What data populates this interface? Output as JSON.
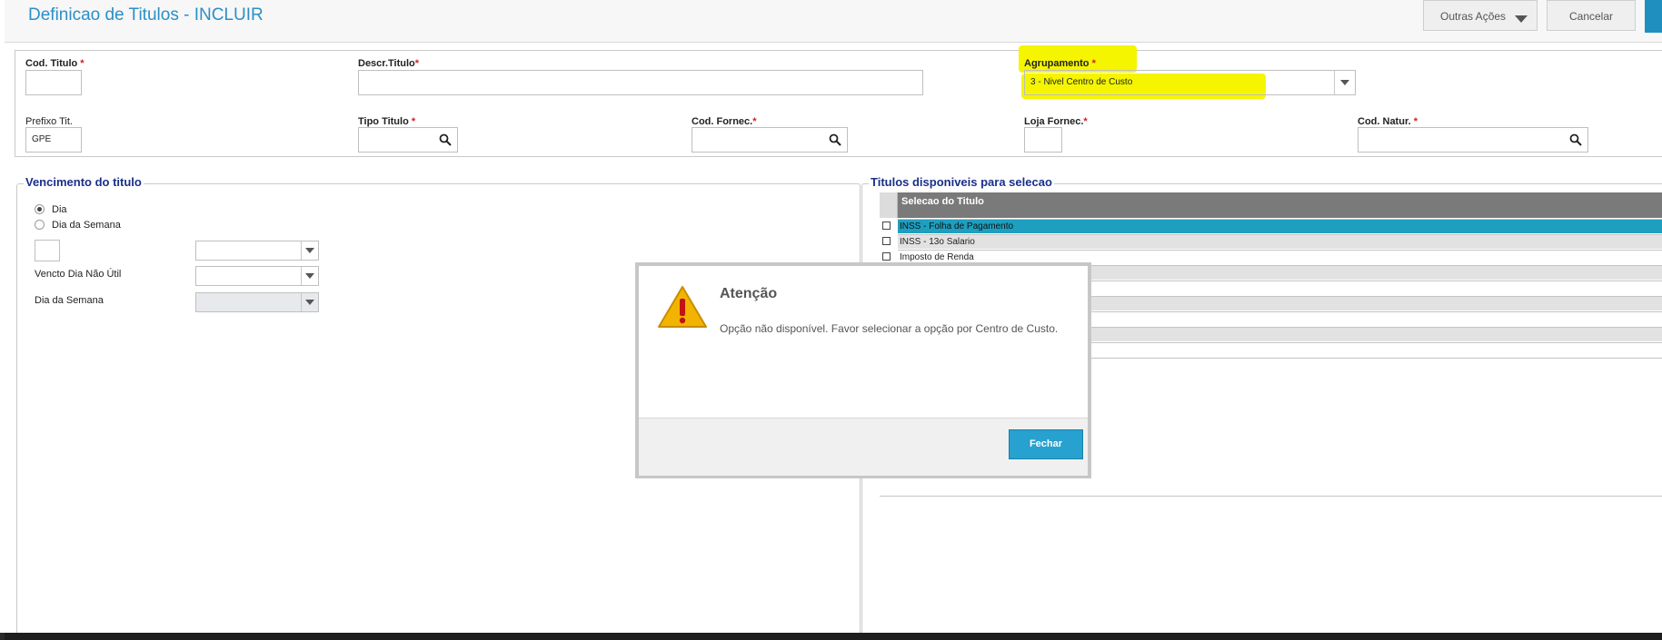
{
  "window": {
    "title": "Definicao de Titulos - INCLUIR"
  },
  "toolbar": {
    "outras_acoes_label": "Outras Ações",
    "cancelar_label": "Cancelar"
  },
  "form": {
    "cod_titulo": {
      "label": "Cod. Titulo",
      "required_mark": "*",
      "value": ""
    },
    "descr_titulo": {
      "label": "Descr.Titulo",
      "required_mark": "*",
      "value": ""
    },
    "agrupamento": {
      "label": "Agrupamento",
      "required_mark": "*",
      "value": "3 - Nivel Centro de Custo"
    },
    "prefixo_tit": {
      "label": "Prefixo Tit.",
      "value": "GPE"
    },
    "tipo_titulo": {
      "label": "Tipo Titulo",
      "required_mark": "*",
      "value": ""
    },
    "cod_fornec": {
      "label": "Cod. Fornec.",
      "required_mark": "*",
      "value": ""
    },
    "loja_fornec": {
      "label": "Loja Fornec.",
      "required_mark": "*",
      "value": ""
    },
    "cod_natur": {
      "label": "Cod. Natur.",
      "required_mark": "*",
      "value": ""
    }
  },
  "vencimento": {
    "legend": "Vencimento do titulo",
    "options": [
      {
        "label": "Dia",
        "selected": true
      },
      {
        "label": "Dia da Semana",
        "selected": false
      }
    ],
    "vencto_label": "Vencto Dia Não Útil",
    "dia_semana_label": "Dia da Semana"
  },
  "titulos": {
    "legend": "Titulos disponiveis para selecao",
    "column_header": "Selecao do Titulo",
    "rows": [
      {
        "label": "INSS - Folha de Pagamento",
        "selected": true
      },
      {
        "label": "INSS - 13o Salario",
        "selected": false
      },
      {
        "label": "Imposto de Renda",
        "selected": false
      }
    ]
  },
  "dialog": {
    "title": "Atenção",
    "message": "Opção não disponível. Favor selecionar a opção por Centro de Custo.",
    "close_label": "Fechar",
    "icon": "warning-icon"
  },
  "colors": {
    "accent": "#2a8fc9",
    "selection": "#1e9fbf",
    "highlight": "#f5f500"
  }
}
